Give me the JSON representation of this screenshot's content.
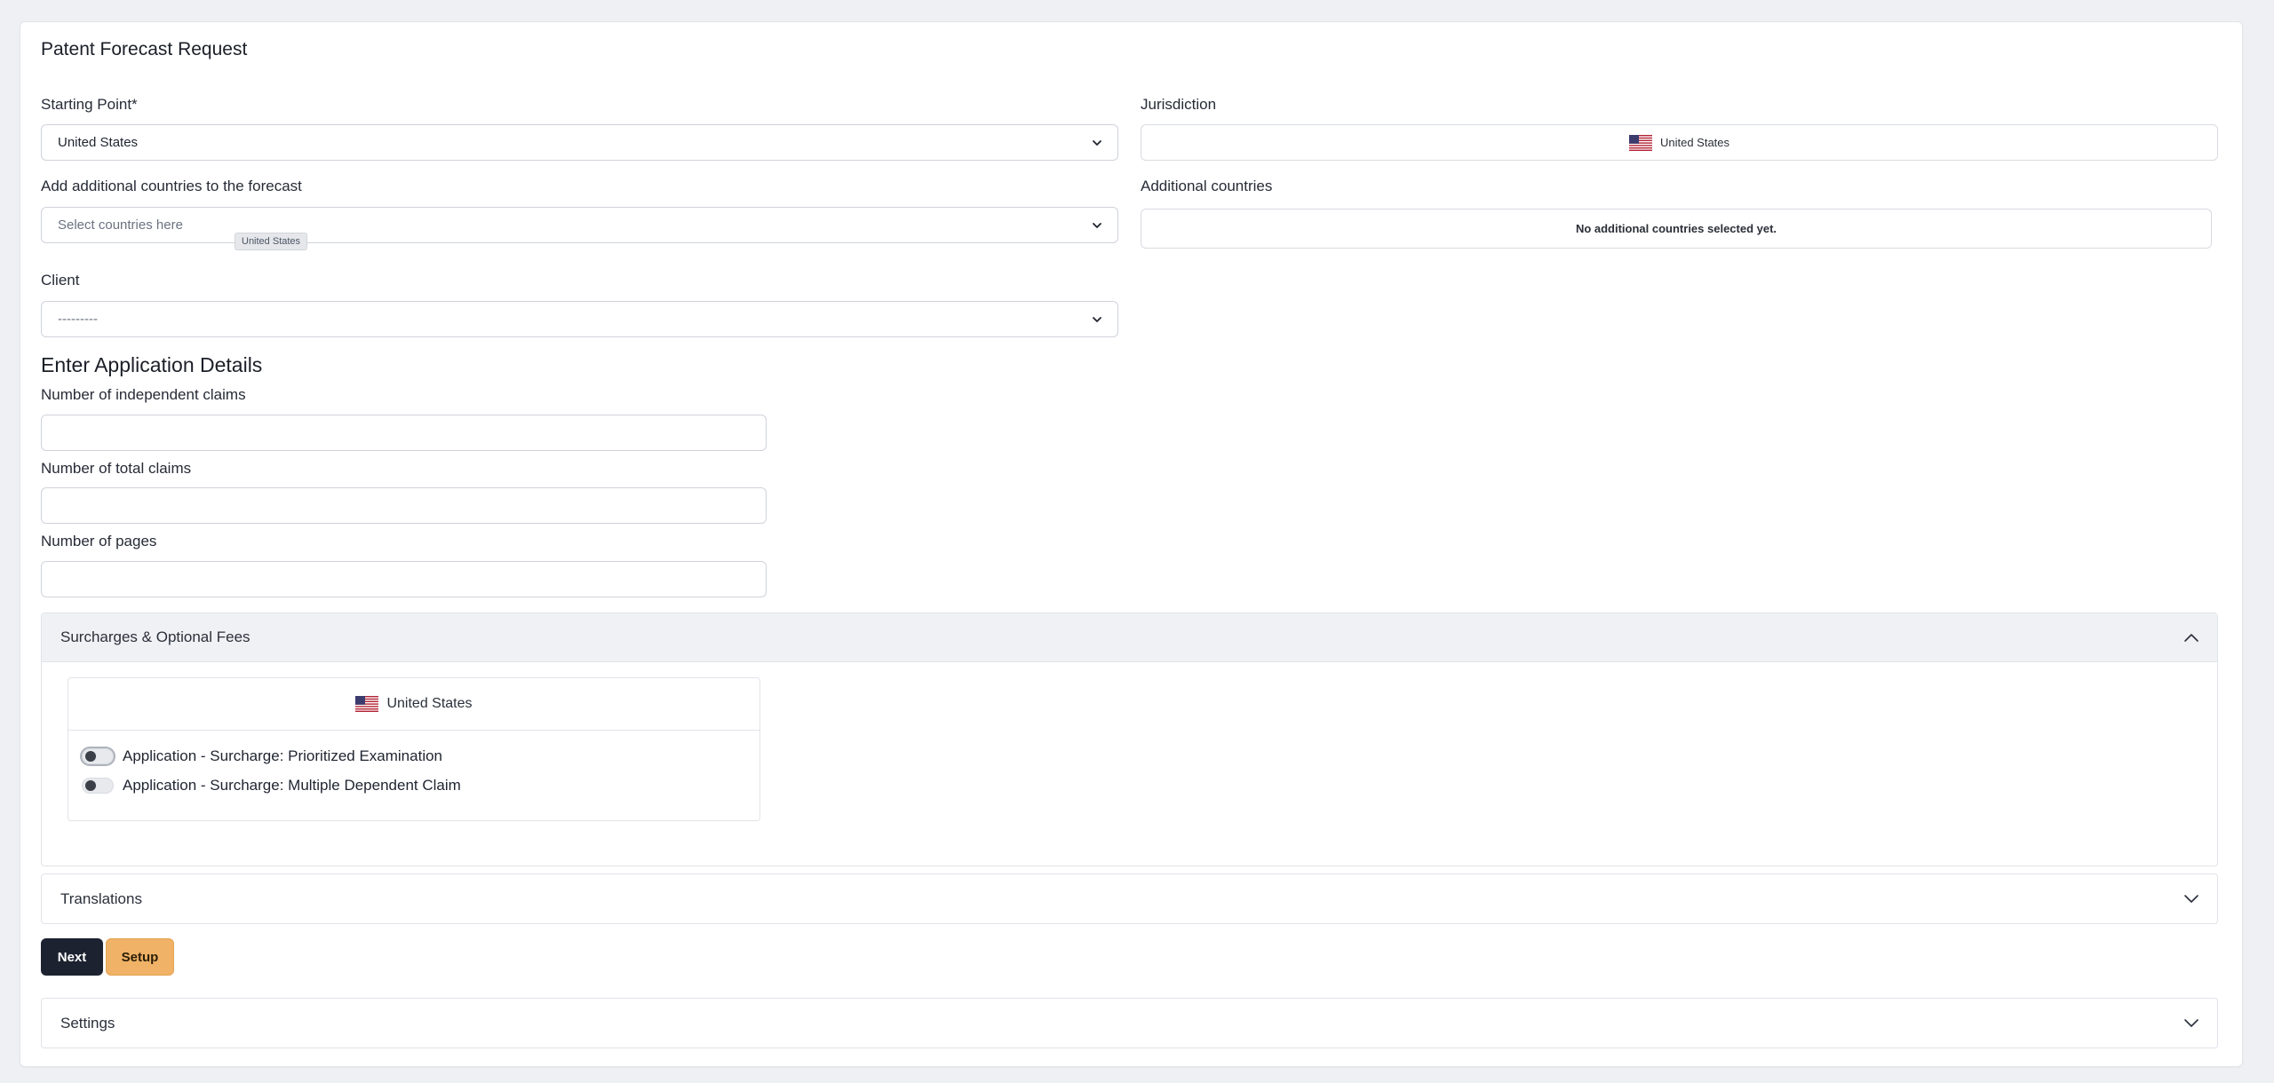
{
  "page": {
    "title": "Patent Forecast Request"
  },
  "starting_point": {
    "label": "Starting Point*",
    "value": "United States"
  },
  "jurisdiction": {
    "label": "Jurisdiction",
    "value": "United States",
    "flag_icon": "us-flag-icon"
  },
  "additional_countries_select": {
    "label": "Add additional countries to the forecast",
    "placeholder": "Select countries here",
    "chip": "United States"
  },
  "additional_countries": {
    "label": "Additional countries",
    "empty_text": "No additional countries selected yet."
  },
  "client": {
    "label": "Client",
    "value": "---------"
  },
  "application_details": {
    "heading": "Enter Application Details",
    "independent_claims_label": "Number of independent claims",
    "total_claims_label": "Number of total claims",
    "pages_label": "Number of pages"
  },
  "surcharges": {
    "title": "Surcharges & Optional Fees",
    "expanded": true,
    "country": "United States",
    "fees": [
      {
        "label": "Application - Surcharge: Prioritized Examination",
        "enabled": false
      },
      {
        "label": "Application - Surcharge: Multiple Dependent Claim",
        "enabled": false
      }
    ]
  },
  "translations": {
    "title": "Translations",
    "expanded": false
  },
  "buttons": {
    "next": "Next",
    "setup": "Setup"
  },
  "settings": {
    "title": "Settings",
    "expanded": false
  },
  "colors": {
    "primary_button": "#1d2230",
    "setup_button": "#f0b266",
    "background": "#eff0f3"
  }
}
